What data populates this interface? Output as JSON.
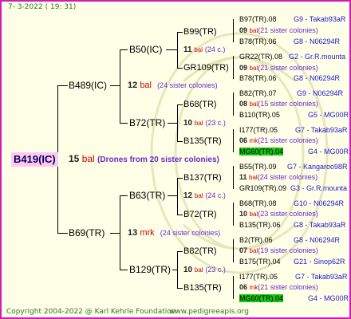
{
  "header": {
    "date": "7- 3-2022",
    "time": "( 19: 31)"
  },
  "footer": {
    "copyright": "Copyright 2004-2022 @ Karl Kehrle Foundation",
    "site": "www.pedigreeapis.org"
  },
  "root": {
    "id": "B419(IC)",
    "num": "15",
    "bal": "bal",
    "note": "(Drones from 20 sister colonies)"
  },
  "gen1": [
    {
      "id": "B489(IC)",
      "num": "12",
      "bal": "bal",
      "note": "(24 sister colonies)"
    },
    {
      "id": "B69(TR)",
      "num": "13",
      "bal": "mrk",
      "note": "(24 sister colonies)"
    }
  ],
  "gen2": [
    {
      "id": "B50(IC)",
      "num": "11",
      "bal": "bal",
      "note": "(24 c.)"
    },
    {
      "id": "B72(TR)",
      "num": "10",
      "bal": "bal",
      "note": "(23 c.)"
    },
    {
      "id": "B63(TR)",
      "num": "12",
      "bal": "bal",
      "note": "(24 c.)"
    },
    {
      "id": "B129(TR)",
      "num": "10",
      "bal": "bal",
      "note": "(23 c.)"
    }
  ],
  "gen3": [
    {
      "id": "B99(TR)",
      "num": "09",
      "bal": "bal",
      "note": "(21 sister colonies)"
    },
    {
      "id": "GR109(TR)",
      "num": "09",
      "bal": "bal",
      "note": "(21 sister colonies)"
    },
    {
      "id": "B68(TR)",
      "num": "08",
      "bal": "bal",
      "note": "(15 sister colonies)"
    },
    {
      "id": "B135(TR)",
      "num": "06",
      "bal": "mk",
      "note": "(21 sister colonies)"
    },
    {
      "id": "B137(TR)",
      "num": "11",
      "bal": "bal",
      "note": "(24 sister colonies)"
    },
    {
      "id": "B72(TR)",
      "num": "10",
      "bal": "bal",
      "note": "(23 sister colonies)"
    },
    {
      "id": "B82(TR)",
      "num": "07",
      "bal": "bal",
      "note": "(19 sister colonies)"
    },
    {
      "id": "B135(TR)",
      "num": "06",
      "bal": "mk",
      "note": "(21 sister colonies)"
    }
  ],
  "gen4": [
    {
      "id": "B97(TR).08",
      "place": "G9 - Takab93aR"
    },
    {
      "id": "B78(TR).06",
      "place": "G8 - N06294R"
    },
    {
      "id": "GR22(TR).08",
      "place": "G2 - Gr.R.mounta"
    },
    {
      "id": "B78(TR).06",
      "place": "G8 - N06294R"
    },
    {
      "id": "B82(TR).07",
      "place": "G9 - N06294R"
    },
    {
      "id": "B110(TR).05",
      "place": "G5 - MG00R"
    },
    {
      "id": "I177(TR).05",
      "place": "G7 - Takab93aR"
    },
    {
      "id": "MG60(TR).04",
      "place": "G4 - MG00R"
    },
    {
      "id": "B55(TR).09",
      "place": "G7 - Kangaroo98R"
    },
    {
      "id": "GR109(TR).09",
      "place": "G3 - Gr.R.mounta"
    },
    {
      "id": "B68(TR).08",
      "place": "G10 - N06294R"
    },
    {
      "id": "B135(TR).06",
      "place": "G8 - Takab93aR"
    },
    {
      "id": "B2(TR).06",
      "place": "G8 - N06294R"
    },
    {
      "id": "B175(TR).04",
      "place": "G21 - Sinop62R"
    },
    {
      "id": "I177(TR).05",
      "place": "G7 - Takab93aR"
    },
    {
      "id": "MG60(TR).04",
      "place": "G4 - MG00R"
    }
  ]
}
